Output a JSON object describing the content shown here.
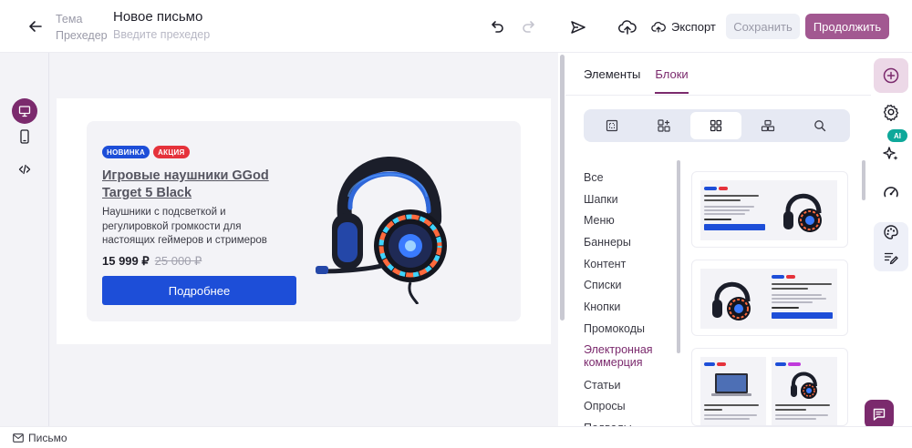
{
  "header": {
    "labels": {
      "subject": "Тема",
      "preheader": "Прехедер"
    },
    "subject_value": "Новое письмо",
    "preheader_placeholder": "Введите прехедер",
    "export_label": "Экспорт",
    "save_label": "Сохранить",
    "continue_label": "Продолжить"
  },
  "banner": {
    "badges": [
      "НОВИНКА",
      "АКЦИЯ"
    ],
    "title": "Игровые наушники GGod Target 5 Black",
    "description": "Наушники с подсветкой и регулировкой громкости для настоящих геймеров и стримеров",
    "price_new": "15 999 ₽",
    "price_old": "25 000 ₽",
    "button_label": "Подробнее"
  },
  "panel": {
    "tabs": [
      "Элементы",
      "Блоки"
    ],
    "active_tab": "Блоки",
    "categories": [
      "Все",
      "Шапки",
      "Меню",
      "Баннеры",
      "Контент",
      "Списки",
      "Кнопки",
      "Промокоды",
      "Электронная коммерция",
      "Статьи",
      "Опросы",
      "Подвалы"
    ],
    "active_category": "Электронная коммерция"
  },
  "rail": {
    "ai_badge": "AI"
  },
  "footer": {
    "tab_label": "Письмо"
  },
  "colors": {
    "brand": "#a25891",
    "brand_dark": "#7b2a6d",
    "primary_button": "#1d4ed8",
    "sale_badge": "#e5323b",
    "ai_badge": "#0ea89a"
  }
}
